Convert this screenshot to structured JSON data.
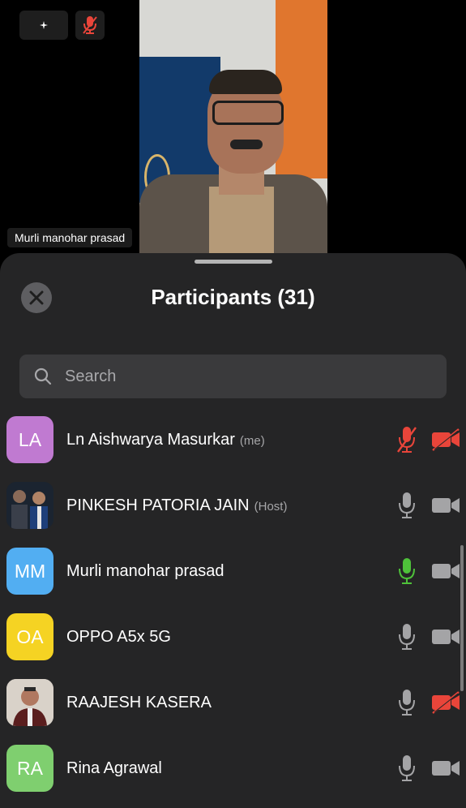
{
  "top_controls": {
    "sparkle_icon": "sparkle-icon",
    "mic_muted_icon": "mic-muted-icon"
  },
  "video": {
    "name_label": "Murli manohar prasad"
  },
  "sheet": {
    "title": "Participants (31)",
    "search_placeholder": "Search"
  },
  "participants": [
    {
      "initials": "LA",
      "name": "Ln Aishwarya Masurkar",
      "tag": "(me)",
      "avatar_color": "#c07ad1",
      "mic": "muted",
      "camera": "off"
    },
    {
      "initials": "",
      "name": "PINKESH PATORIA JAIN",
      "tag": "(Host)",
      "avatar_color": "#1b2430",
      "mic": "on",
      "camera": "on"
    },
    {
      "initials": "MM",
      "name": "Murli manohar prasad",
      "tag": "",
      "avatar_color": "#52aef2",
      "mic": "speaking",
      "camera": "on"
    },
    {
      "initials": "OA",
      "name": "OPPO A5x 5G",
      "tag": "",
      "avatar_color": "#f5d323",
      "mic": "on",
      "camera": "on"
    },
    {
      "initials": "",
      "name": "RAAJESH KASERA",
      "tag": "",
      "avatar_color": "#d9d2c9",
      "mic": "on",
      "camera": "off"
    },
    {
      "initials": "RA",
      "name": "Rina Agrawal",
      "tag": "",
      "avatar_color": "#7fcf6f",
      "mic": "on",
      "camera": "on"
    }
  ],
  "colors": {
    "muted_red": "#e9453a",
    "speaking_green": "#4ec13a",
    "icon_gray": "#a4a4a6"
  }
}
